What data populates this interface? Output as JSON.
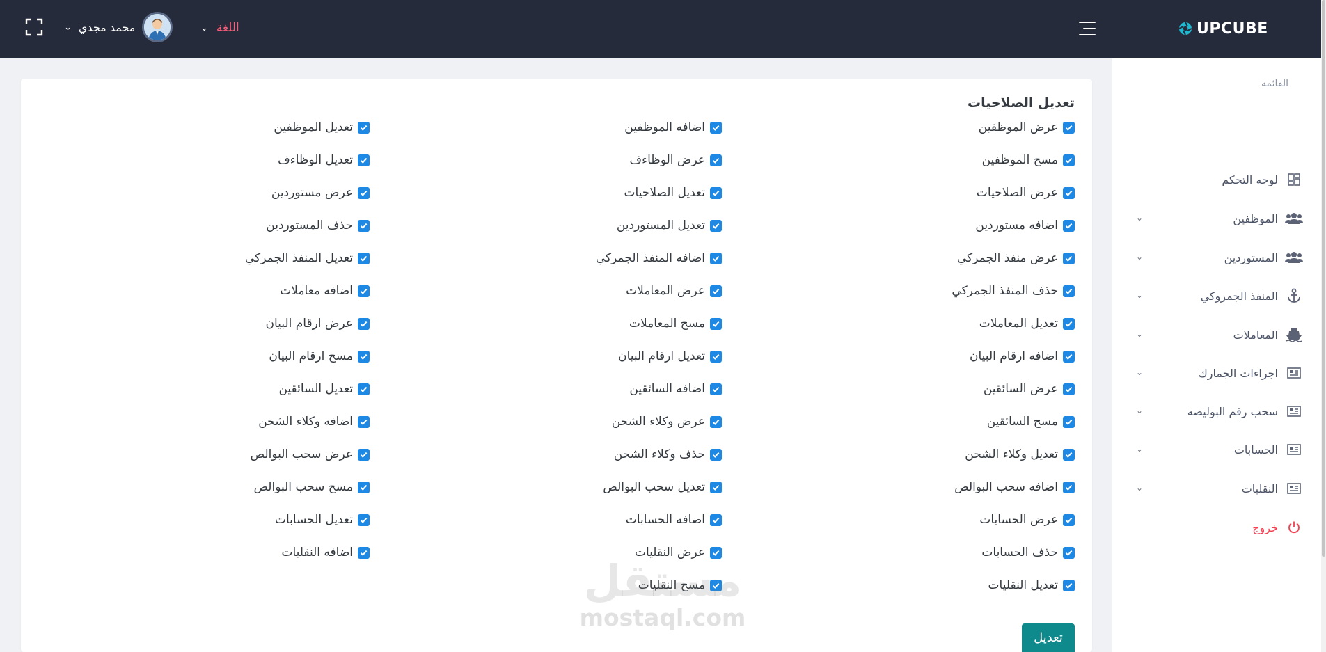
{
  "header": {
    "logo_text": "UPCUBE",
    "language_label": "اللغة",
    "user_name": "محمد مجدي"
  },
  "sidebar": {
    "section_title": "القائمه",
    "items": [
      {
        "label": "لوحه التحكم",
        "icon": "dashboard-icon",
        "has_submenu": false
      },
      {
        "label": "الموظفين",
        "icon": "users-icon",
        "has_submenu": true
      },
      {
        "label": "المستوردين",
        "icon": "users-icon",
        "has_submenu": true
      },
      {
        "label": "المنفذ الجمروكي",
        "icon": "anchor-icon",
        "has_submenu": true
      },
      {
        "label": "المعاملات",
        "icon": "ship-icon",
        "has_submenu": true
      },
      {
        "label": "اجراءات الجمارك",
        "icon": "newspaper-icon",
        "has_submenu": true
      },
      {
        "label": "سحب رقم البوليصه",
        "icon": "newspaper-icon",
        "has_submenu": true
      },
      {
        "label": "الحسابات",
        "icon": "newspaper-icon",
        "has_submenu": true
      },
      {
        "label": "النقليات",
        "icon": "newspaper-icon",
        "has_submenu": true
      }
    ],
    "logout_label": "خروج"
  },
  "main": {
    "title": "تعديل الصلاحيات",
    "submit_label": "تعديل",
    "permissions": {
      "col1": [
        "عرض الموظفين",
        "مسح الموظفين",
        "عرض الصلاحيات",
        "اضافه مستوردين",
        "عرض منفذ الجمركي",
        "حذف المنفذ الجمركي",
        "تعديل المعاملات",
        "اضافه ارقام البيان",
        "عرض السائقين",
        "مسح السائقين",
        "تعديل وكلاء الشحن",
        "اضافه سحب البوالص",
        "عرض الحسابات",
        "حذف الحسابات",
        "تعديل النقليات"
      ],
      "col2": [
        "اضافه الموظفين",
        "عرض الوظاءف",
        "تعديل الصلاحيات",
        "تعديل المستوردين",
        "اضافه المنفذ الجمركي",
        "عرض المعاملات",
        "مسح المعاملات",
        "تعديل ارقام البيان",
        "اضافه السائقين",
        "عرض وكلاء الشحن",
        "حذف وكلاء الشحن",
        "تعديل سحب البوالص",
        "اضافه الحسابات",
        "عرض النقليات",
        "مسح النقليات"
      ],
      "col3": [
        "تعديل الموظفين",
        "تعديل الوظاءف",
        "عرض مستوردين",
        "حذف المستوردين",
        "تعديل المنفذ الجمركي",
        "اضافه معاملات",
        "عرض ارقام البيان",
        "مسح ارقام البيان",
        "تعديل السائقين",
        "اضافه وكلاء الشحن",
        "عرض سحب البوالص",
        "مسح سحب البوالص",
        "تعديل الحسابات",
        "اضافه النقليات"
      ]
    }
  },
  "watermark": {
    "arabic": "مستقل",
    "latin": "mostaql.com"
  },
  "colors": {
    "topbar": "#252b3b",
    "checkbox": "#1e88e5",
    "submit_button": "#0e8a8c",
    "language_label": "#ff5a78",
    "logout": "#f03e4f"
  }
}
